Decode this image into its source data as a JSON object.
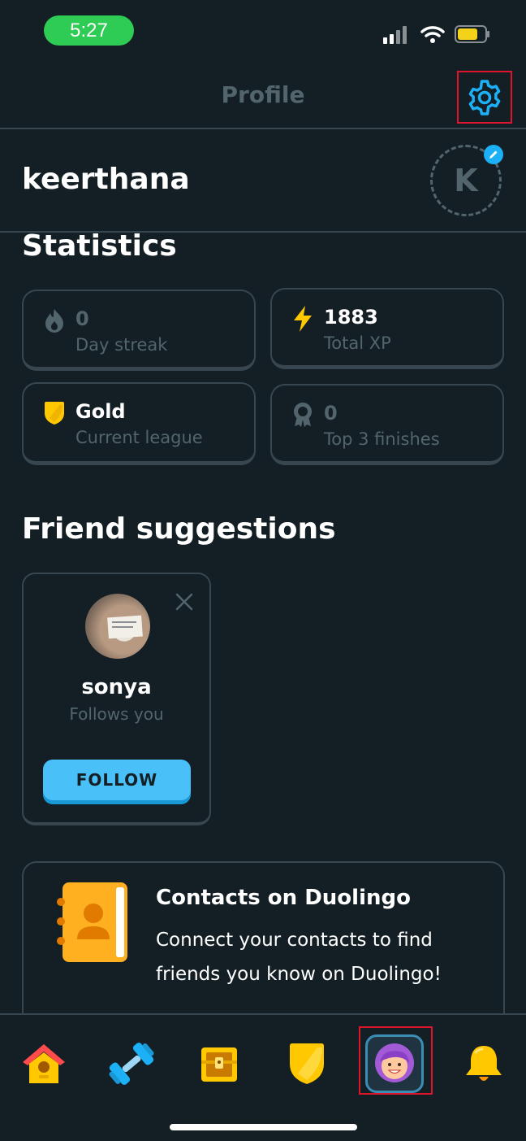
{
  "status_bar": {
    "time": "5:27"
  },
  "header": {
    "title": "Profile"
  },
  "profile": {
    "username": "keerthana",
    "avatar_initial": "K"
  },
  "statistics": {
    "title": "Statistics",
    "cards": [
      {
        "icon": "flame-icon",
        "value": "0",
        "label": "Day streak"
      },
      {
        "icon": "lightning-icon",
        "value": "1883",
        "label": "Total XP"
      },
      {
        "icon": "gold-shield-icon",
        "value": "Gold",
        "label": "Current league"
      },
      {
        "icon": "medal-icon",
        "value": "0",
        "label": "Top 3 finishes"
      }
    ]
  },
  "friend_suggestions": {
    "title": "Friend suggestions",
    "items": [
      {
        "name": "sonya",
        "status": "Follows you",
        "button": "FOLLOW"
      }
    ]
  },
  "contacts": {
    "title": "Contacts on Duolingo",
    "description": "Connect your contacts to find friends you know on Duolingo!"
  },
  "bottom_nav": [
    "home-icon",
    "practice-dumbbell-icon",
    "treasure-chest-icon",
    "league-shield-icon",
    "profile-avatar-icon",
    "notifications-bell-icon"
  ],
  "colors": {
    "background": "#131f24",
    "accent": "#1cb0f6",
    "border": "#37464f",
    "muted": "#52656d",
    "highlight": "#e0142c"
  }
}
